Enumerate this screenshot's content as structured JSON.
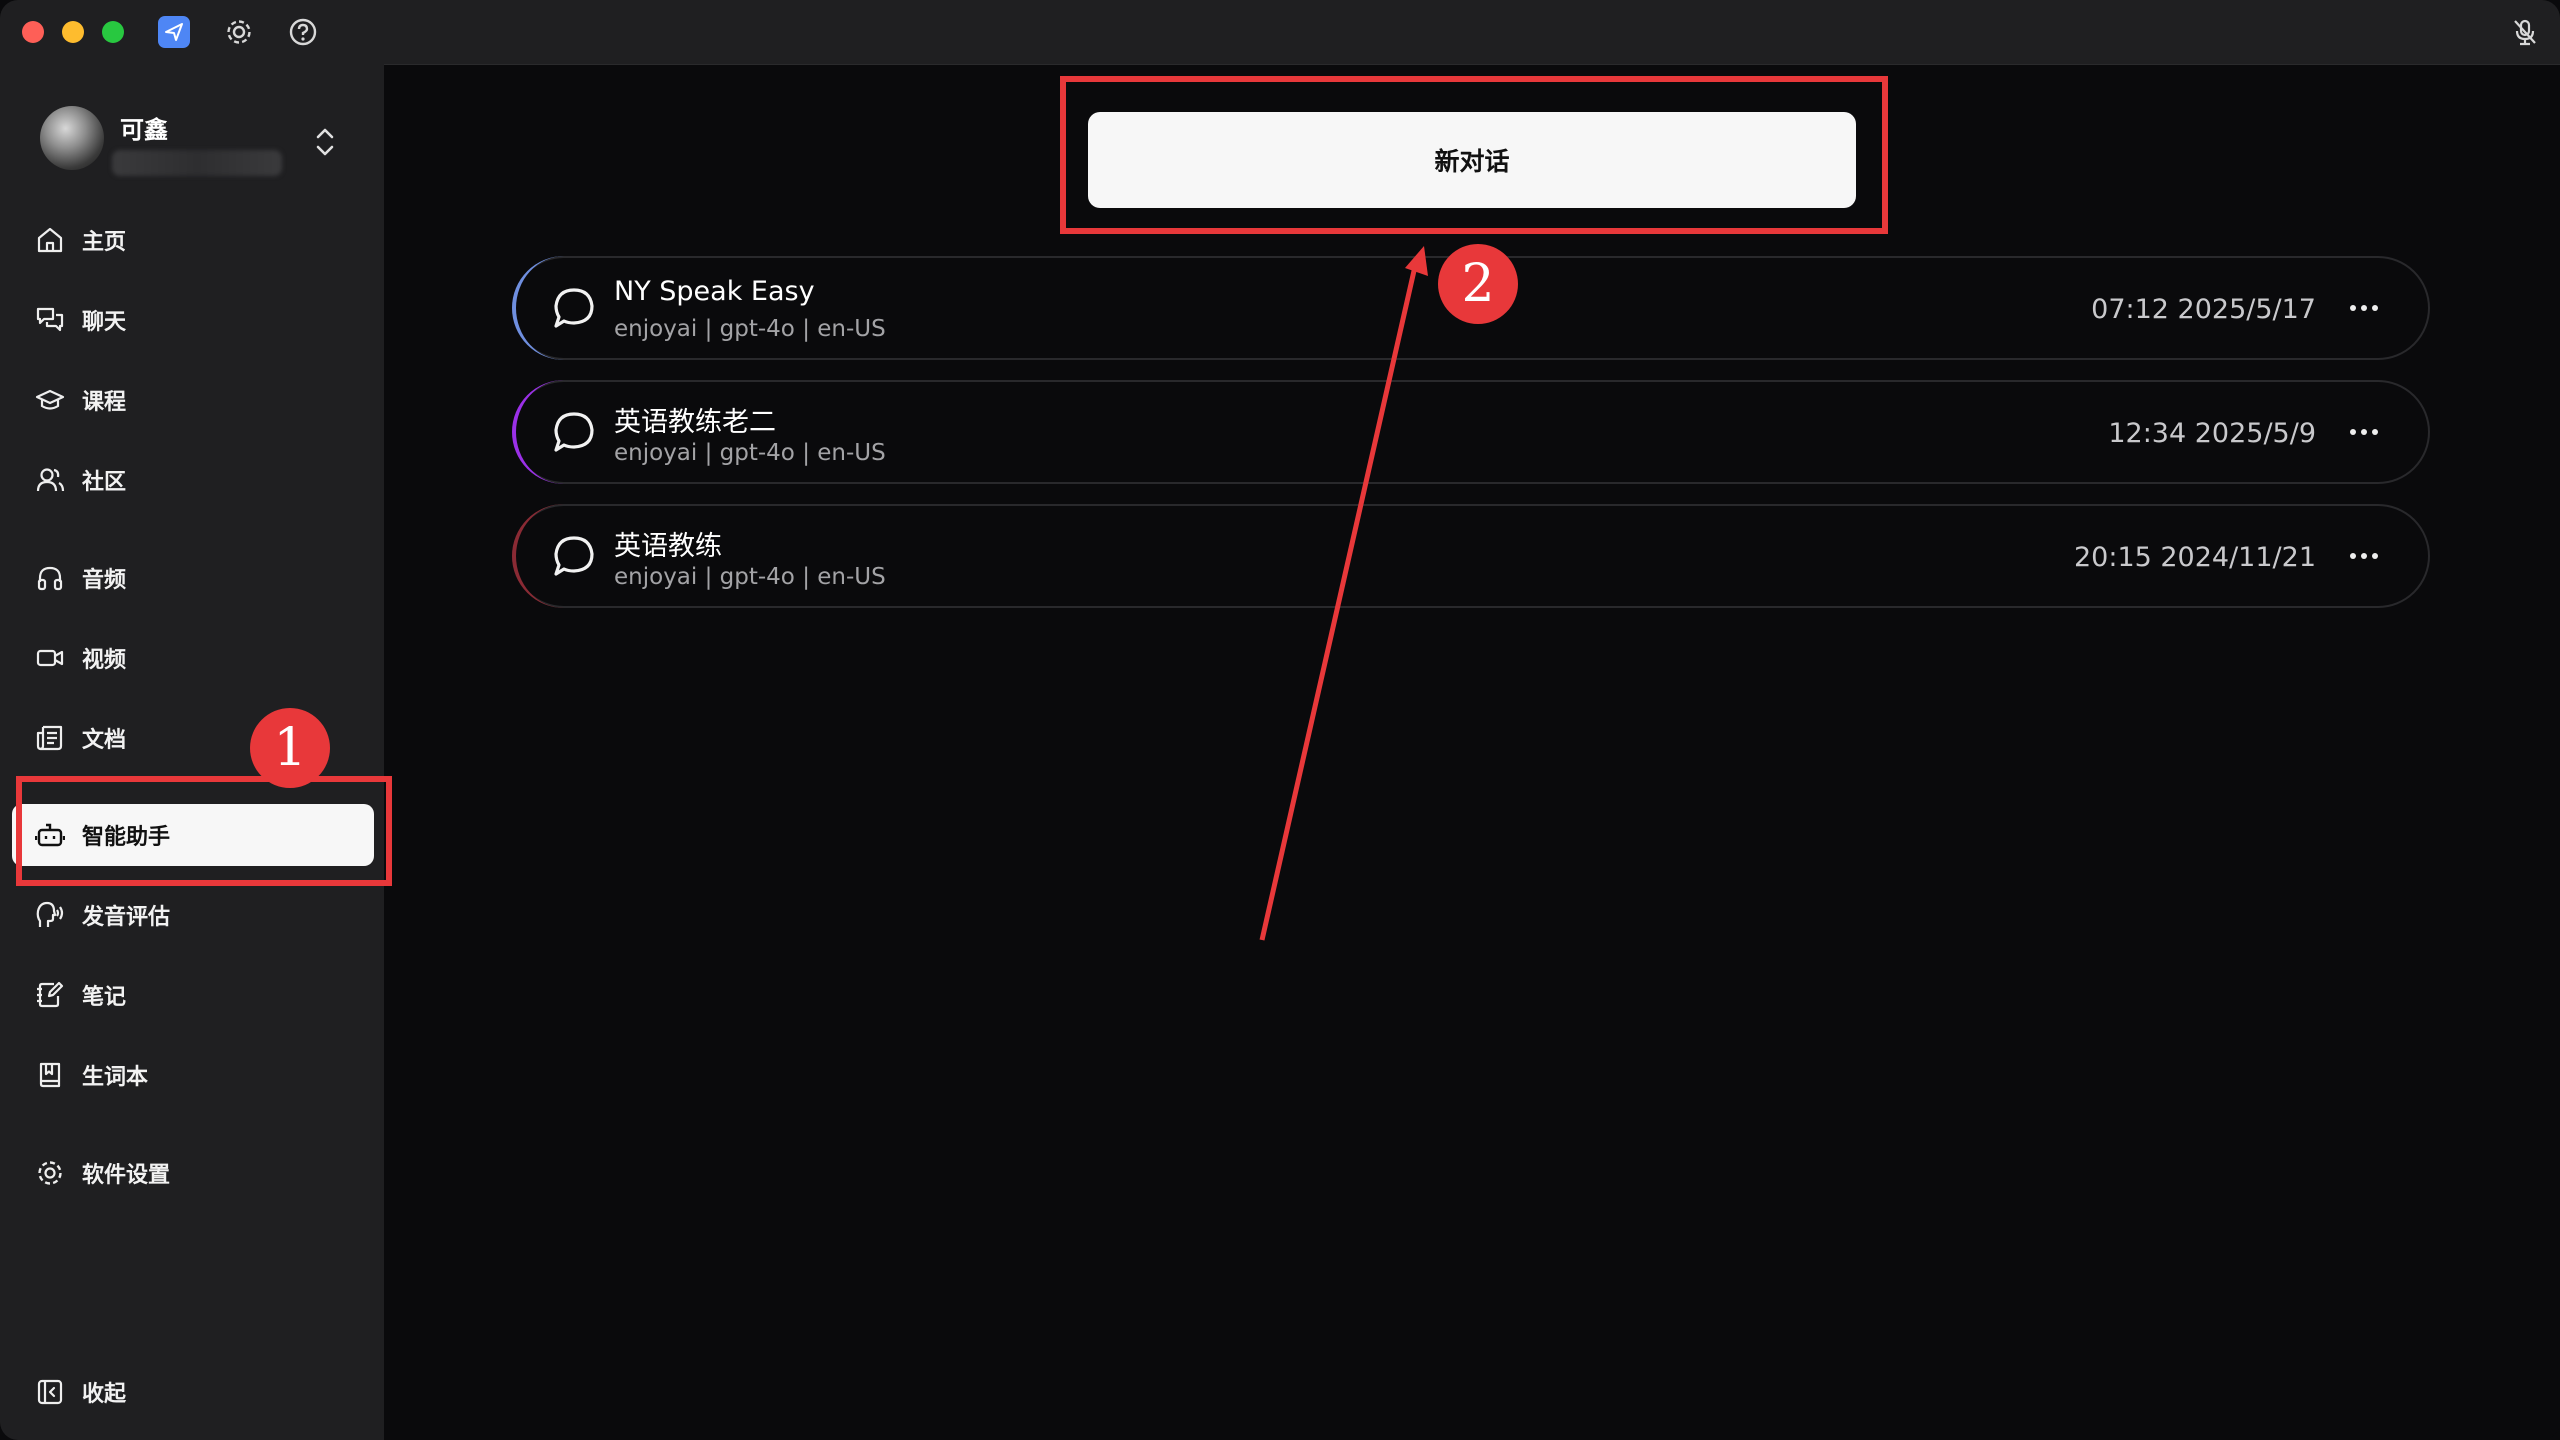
{
  "profile": {
    "name": "可鑫"
  },
  "nav": {
    "home": "主页",
    "chat": "聊天",
    "courses": "课程",
    "community": "社区",
    "audio": "音频",
    "video": "视频",
    "documents": "文档",
    "assistant": "智能助手",
    "pronunciation": "发音评估",
    "notes": "笔记",
    "vocabulary": "生词本",
    "settings": "软件设置",
    "collapse": "收起"
  },
  "main": {
    "new_chat_label": "新对话",
    "conversations": [
      {
        "title": "NY Speak Easy",
        "subtitle": "enjoyai | gpt-4o | en-US",
        "time": "07:12 2025/5/17",
        "accent": "#6f8fe0"
      },
      {
        "title": "英语教练老二",
        "subtitle": "enjoyai | gpt-4o | en-US",
        "time": "12:34 2025/5/9",
        "accent": "#9b30e8"
      },
      {
        "title": "英语教练",
        "subtitle": "enjoyai | gpt-4o | en-US",
        "time": "20:15 2024/11/21",
        "accent": "#8a2a34"
      }
    ]
  },
  "annotations": {
    "badge_1": "1",
    "badge_2": "2",
    "color": "#e8383a"
  }
}
